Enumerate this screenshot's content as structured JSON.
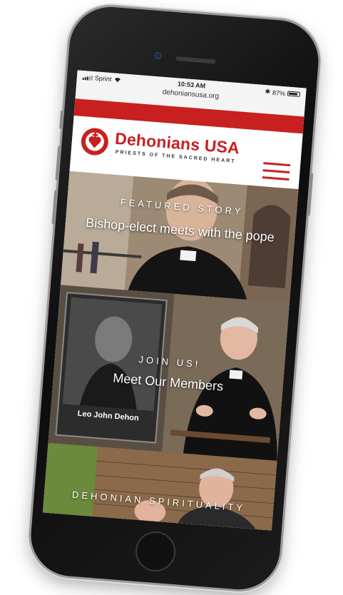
{
  "status": {
    "carrier": "Sprint",
    "time": "10:53 AM",
    "url": "dehoniansusa.org",
    "battery": "87%",
    "battery_level": 0.87
  },
  "brand": {
    "title": "Dehonians USA",
    "subtitle": "PRIESTS OF THE SACRED HEART",
    "accent": "#c8201f"
  },
  "menu": {
    "icon": "hamburger-menu-icon"
  },
  "tiles": [
    {
      "kicker": "FEATURED STORY",
      "heading": "Bishop-elect meets with the pope"
    },
    {
      "kicker": "JOIN US!",
      "heading": "Meet Our Members",
      "portrait_caption": "Leo John Dehon"
    },
    {
      "kicker": "DEHONIAN SPIRITUALITY"
    }
  ]
}
